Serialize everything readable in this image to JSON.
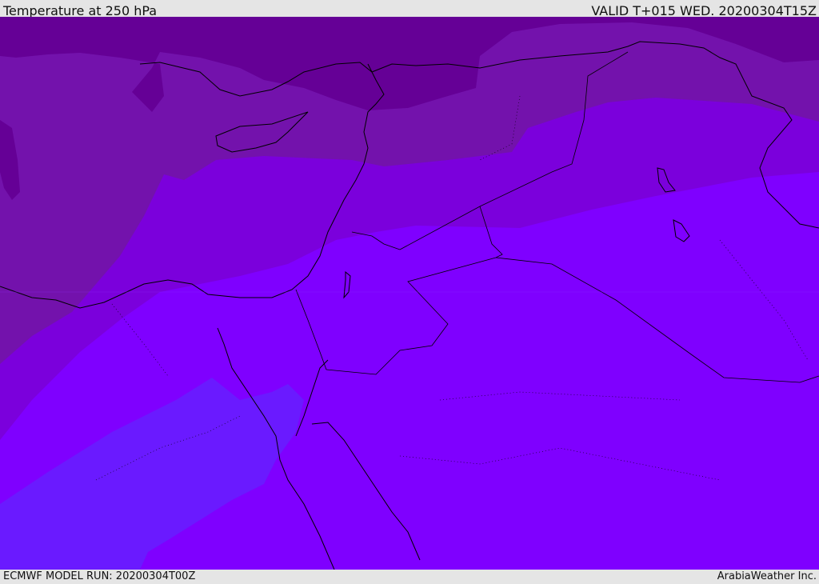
{
  "header": {
    "title": "Temperature at 250 hPa",
    "valid": "VALID T+015 WED. 20200304T15Z"
  },
  "footer": {
    "model_run": "ECMWF MODEL RUN: 20200304T00Z",
    "credit": "ArabiaWeather Inc."
  },
  "colors": {
    "band1": "#650096",
    "band2": "#7312ac",
    "band3": "#7b00dc",
    "band4": "#7f00ff",
    "band5": "#6a1aff",
    "border": "#000000"
  }
}
